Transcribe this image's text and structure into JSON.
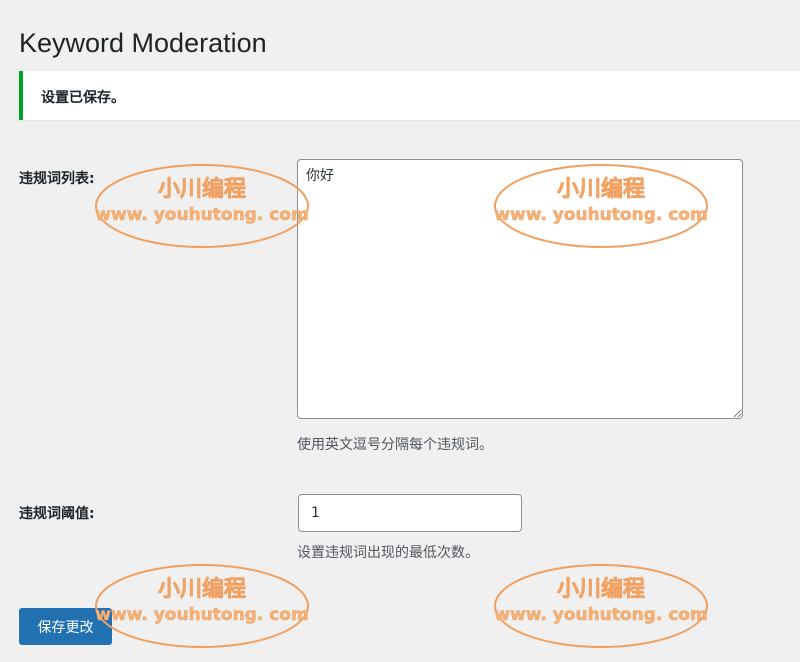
{
  "page": {
    "title": "Keyword Moderation"
  },
  "notice": {
    "text": "设置已保存。",
    "accent_color": "#00a32a"
  },
  "fields": {
    "keywords": {
      "label": "违规词列表:",
      "value": "你好",
      "description": "使用英文逗号分隔每个违规词。"
    },
    "threshold": {
      "label": "违规词阈值:",
      "value": "1",
      "description": "设置违规词出现的最低次数。"
    }
  },
  "actions": {
    "save_label": "保存更改",
    "primary_color": "#2271b1"
  },
  "watermark": {
    "line1": "小川编程",
    "line2": "www. youhutong. com",
    "color": "#f0a060"
  }
}
